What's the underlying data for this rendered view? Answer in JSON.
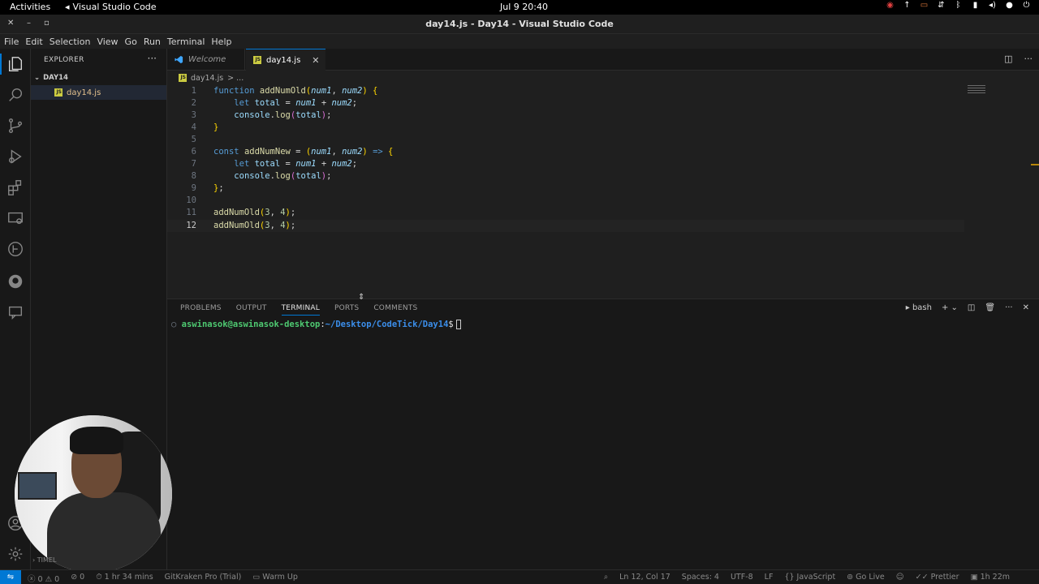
{
  "topbar": {
    "activities": "Activities",
    "app_name": "Visual Studio Code",
    "clock": "Jul 9  20:40"
  },
  "window": {
    "title": "day14.js - Day14 - Visual Studio Code"
  },
  "menu": [
    "File",
    "Edit",
    "Selection",
    "View",
    "Go",
    "Run",
    "Terminal",
    "Help"
  ],
  "sidebar": {
    "header": "EXPLORER",
    "folder": "DAY14",
    "files": [
      {
        "name": "day14.js"
      }
    ]
  },
  "tabs": [
    {
      "label": "Welcome",
      "active": false
    },
    {
      "label": "day14.js",
      "active": true
    }
  ],
  "breadcrumb": {
    "file": "day14.js",
    "rest": "> ..."
  },
  "editor": {
    "current_line": 12,
    "lines": [
      {
        "n": "1",
        "text": "function addNumOld(num1, num2) {"
      },
      {
        "n": "2",
        "text": "    let total = num1 + num2;"
      },
      {
        "n": "3",
        "text": "    console.log(total);"
      },
      {
        "n": "4",
        "text": "}"
      },
      {
        "n": "5",
        "text": ""
      },
      {
        "n": "6",
        "text": "const addNumNew = (num1, num2) => {"
      },
      {
        "n": "7",
        "text": "    let total = num1 + num2;"
      },
      {
        "n": "8",
        "text": "    console.log(total);"
      },
      {
        "n": "9",
        "text": "};"
      },
      {
        "n": "10",
        "text": ""
      },
      {
        "n": "11",
        "text": "addNumOld(3, 4);"
      },
      {
        "n": "12",
        "text": "addNumOld(3, 4);"
      }
    ]
  },
  "panel": {
    "tabs": [
      "PROBLEMS",
      "OUTPUT",
      "TERMINAL",
      "PORTS",
      "COMMENTS"
    ],
    "active_tab": "TERMINAL",
    "shell": "bash",
    "prompt_user": "aswinasok@aswinasok-desktop",
    "prompt_sep": ":",
    "prompt_path": "~/Desktop/CodeTick/Day14",
    "prompt_symbol": "$"
  },
  "timeline_label": "TIMEL",
  "statusbar": {
    "errors": "0",
    "warnings": "0",
    "ports": "0",
    "timer": "1 hr 34 mins",
    "gitkraken": "GitKraken Pro (Trial)",
    "warmup": "Warm Up",
    "position": "Ln 12, Col 17",
    "spaces": "Spaces: 4",
    "encoding": "UTF-8",
    "eol": "LF",
    "language": "JavaScript",
    "golive": "Go Live",
    "prettier": "Prettier",
    "time2": "1h 22m"
  },
  "colors": {
    "accent": "#0078d4",
    "js_badge": "#cbcb41",
    "keyword": "#569cd6",
    "function": "#dcdcaa",
    "variable": "#9cdcfe"
  }
}
